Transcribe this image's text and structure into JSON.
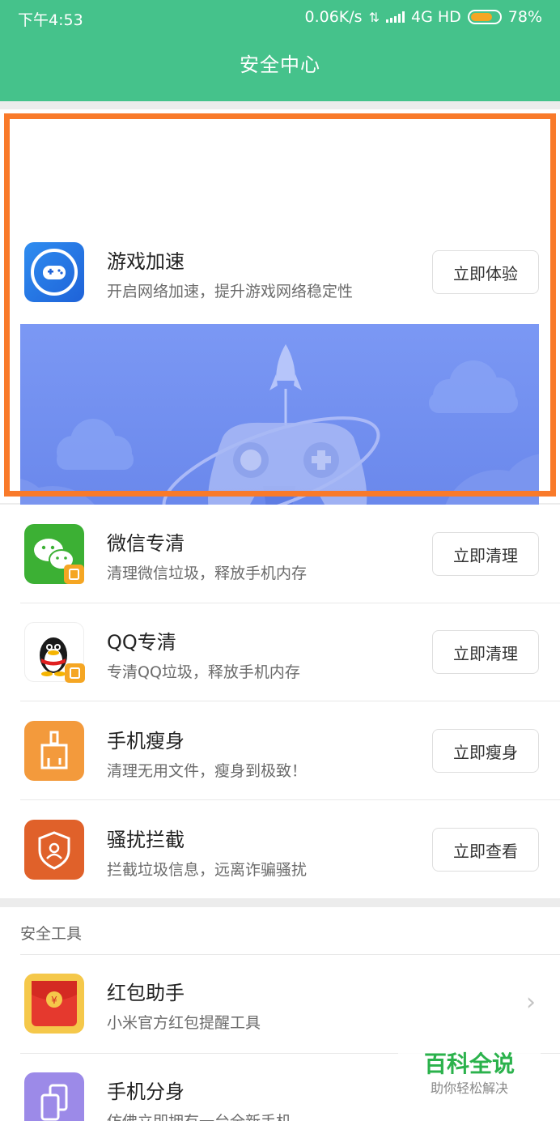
{
  "status": {
    "time": "下午4:53",
    "network_speed": "0.06K/s",
    "net_type": "4G HD",
    "battery": "78%",
    "battery_level": 0.78
  },
  "header": {
    "title": "安全中心"
  },
  "featured": {
    "title": "游戏加速",
    "subtitle": "开启网络加速，提升游戏网络稳定性",
    "button": "立即体验",
    "icon": "gamepad-icon"
  },
  "items": [
    {
      "title": "微信专清",
      "subtitle": "清理微信垃圾，释放手机内存",
      "button": "立即清理",
      "icon": "wechat-icon"
    },
    {
      "title": "QQ专清",
      "subtitle": "专清QQ垃圾，释放手机内存",
      "button": "立即清理",
      "icon": "qq-penguin-icon"
    },
    {
      "title": "手机瘦身",
      "subtitle": "清理无用文件，瘦身到极致！",
      "button": "立即瘦身",
      "icon": "broom-icon"
    },
    {
      "title": "骚扰拦截",
      "subtitle": "拦截垃圾信息，远离诈骗骚扰",
      "button": "立即查看",
      "icon": "shield-user-icon"
    }
  ],
  "tools": {
    "section_title": "安全工具",
    "items": [
      {
        "title": "红包助手",
        "subtitle": "小米官方红包提醒工具",
        "icon": "red-envelope-icon"
      },
      {
        "title": "手机分身",
        "subtitle": "仿佛立即拥有一台全新手机",
        "icon": "dual-phone-icon"
      }
    ]
  },
  "watermark": {
    "title": "百科全说",
    "subtitle": "助你轻松解决"
  },
  "colors": {
    "header": "#45c28b",
    "highlight": "#f97a2a",
    "banner": "#6f8ff0"
  }
}
